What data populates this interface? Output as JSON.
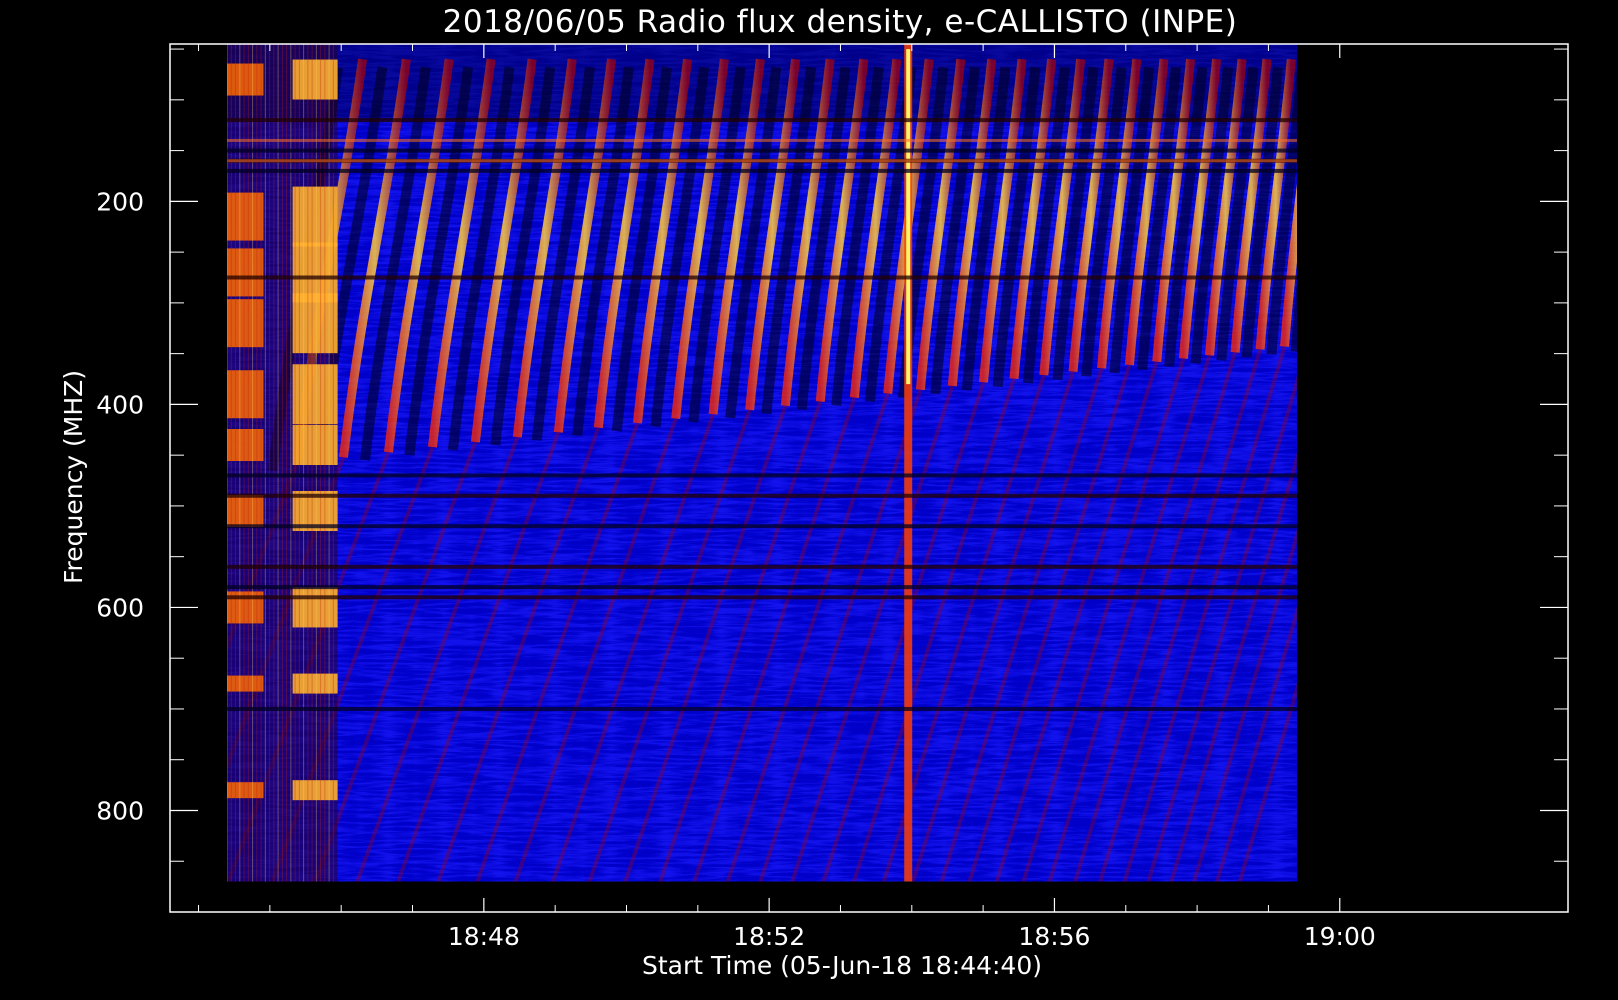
{
  "chart_data": {
    "type": "heatmap",
    "title": "2018/06/05  Radio flux density, e-CALLISTO (INPE)",
    "xlabel": "Start Time (05-Jun-18 18:44:40)",
    "ylabel": "Frequency (MHZ)",
    "x_start": "18:44:40",
    "x_axis": {
      "range_minutes": [
        -0.4,
        19.2
      ],
      "tick_labels": [
        "18:48",
        "18:52",
        "18:56",
        "19:00"
      ],
      "major_ticks_minutes": [
        4,
        8,
        12,
        16
      ],
      "minor_ticks_minutes": [
        0,
        1,
        2,
        3,
        5,
        6,
        7,
        9,
        10,
        11,
        13,
        14,
        15
      ]
    },
    "y_axis": {
      "range_mhz": [
        45,
        900
      ],
      "inverted": true,
      "tick_labels": [
        "200",
        "400",
        "600",
        "800"
      ],
      "major_ticks_mhz": [
        200,
        400,
        600,
        800
      ],
      "minor_ticks_mhz": [
        50,
        100,
        150,
        250,
        300,
        350,
        450,
        500,
        550,
        650,
        700,
        750,
        850
      ]
    },
    "data_extent": {
      "time_minutes": [
        0.4,
        15.4
      ],
      "frequency_mhz": [
        45,
        870
      ]
    },
    "features": {
      "intense_burst_window_minutes": [
        0.7,
        1.95
      ],
      "broadband_spike_minutes": 9.95,
      "interference_bands_mhz": [
        120,
        150,
        160,
        170,
        275,
        470,
        490,
        520,
        560,
        580,
        590,
        700
      ]
    },
    "colormap": [
      "#000010",
      "#0000c8",
      "#1a1aff",
      "#b00000",
      "#ff3000",
      "#ffa000",
      "#ffff60"
    ]
  }
}
